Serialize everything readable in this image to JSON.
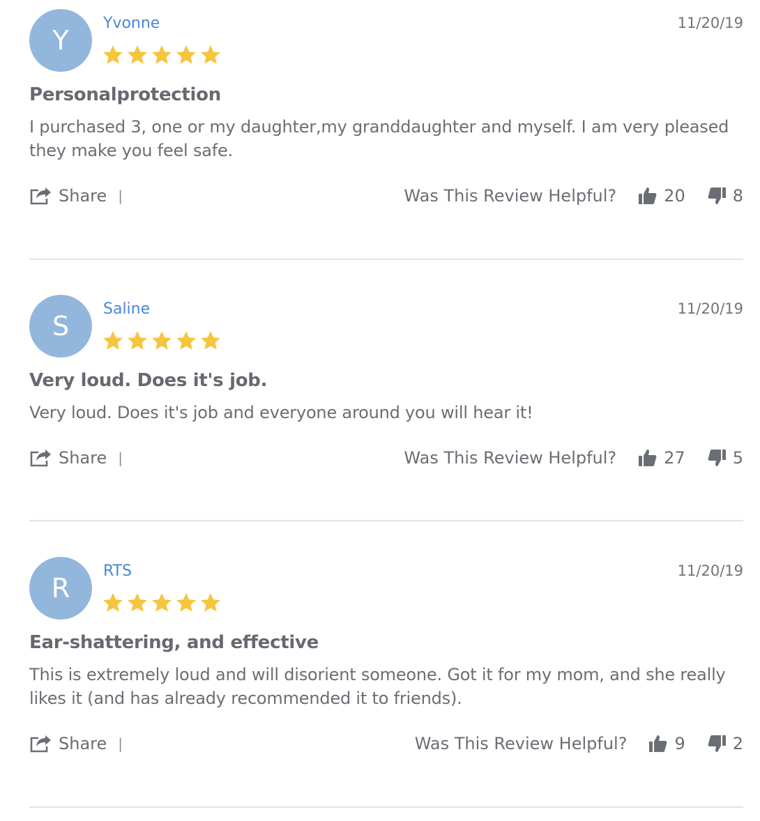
{
  "colors": {
    "avatar_bg": "#93b6dc",
    "author_link": "#4a86d6",
    "star": "#f6c53e",
    "text": "#666a70",
    "divider": "#e3e3e3"
  },
  "helpful_prompt": "Was This Review Helpful?",
  "share_label": "Share",
  "share_separator": "|",
  "reviews": [
    {
      "initial": "Y",
      "author": "Yvonne",
      "date": "11/20/19",
      "rating": 5,
      "title": "Personalprotection",
      "body": "I purchased 3, one or my daughter,my granddaughter and myself. I am very pleased they make you feel safe.",
      "helpful_yes": "20",
      "helpful_no": "8"
    },
    {
      "initial": "S",
      "author": "Saline",
      "date": "11/20/19",
      "rating": 5,
      "title": "Very loud. Does it's job.",
      "body": "Very loud. Does it's job and everyone around you will hear it!",
      "helpful_yes": "27",
      "helpful_no": "5"
    },
    {
      "initial": "R",
      "author": "RTS",
      "date": "11/20/19",
      "rating": 5,
      "title": "Ear-shattering, and effective",
      "body": "This is extremely loud and will disorient someone. Got it for my mom, and she really likes it (and has already recommended it to friends).",
      "helpful_yes": "9",
      "helpful_no": "2"
    }
  ]
}
